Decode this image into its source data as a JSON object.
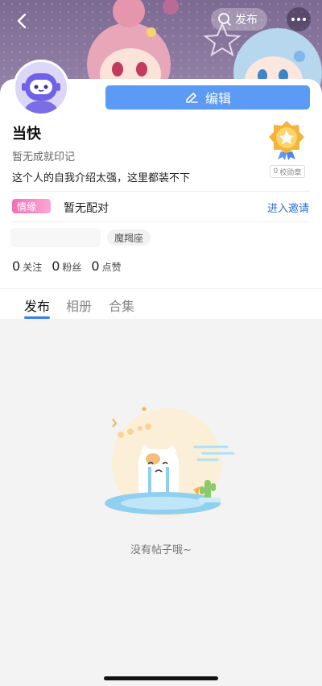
{
  "header": {
    "publish_label": "发布",
    "icons": {
      "back": "chevron-left-icon",
      "search": "search-icon",
      "more": "more-dots-icon"
    }
  },
  "profile": {
    "edit_label": "编辑",
    "username": "当快",
    "achievement": "暂无成就印记",
    "bio": "这个人的自我介绍太强，这里都装不下",
    "medal_count": "0",
    "medal_label": "校勋章"
  },
  "relationship": {
    "tag": "情缘",
    "status": "暂无配对",
    "invite_label": "进入邀请"
  },
  "zodiac": "魔羯座",
  "stats": [
    {
      "value": "0",
      "label": "关注"
    },
    {
      "value": "0",
      "label": "粉丝"
    },
    {
      "value": "0",
      "label": "点赞"
    }
  ],
  "tabs": [
    {
      "label": "发布",
      "active": true
    },
    {
      "label": "相册",
      "active": false
    },
    {
      "label": "合集",
      "active": false
    }
  ],
  "empty_state": {
    "text": "没有帖子哦~"
  },
  "colors": {
    "accent": "#5b9af5",
    "tab_active": "#3a7ef0",
    "tag_pink": "#f36fb7",
    "link": "#2f6fd6"
  }
}
